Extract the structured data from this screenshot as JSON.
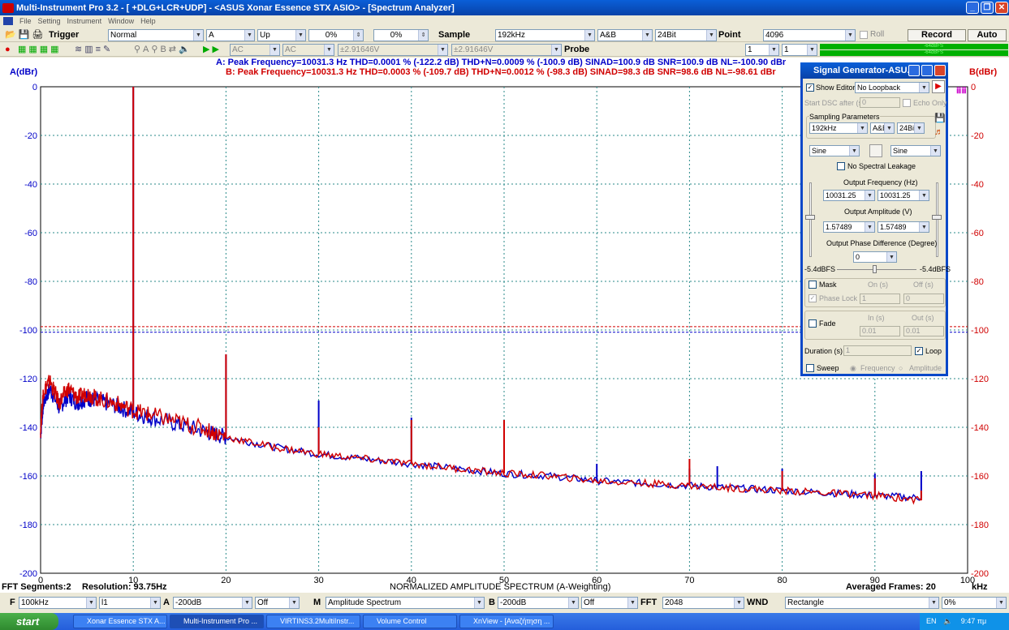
{
  "app": {
    "title": "Multi-Instrument Pro 3.2   - [ +DLG+LCR+UDP]   - <ASUS Xonar Essence STX ASIO> - [Spectrum Analyzer]"
  },
  "menu": [
    "File",
    "Setting",
    "Instrument",
    "Window",
    "Help"
  ],
  "toolbar1": {
    "trigger_label": "Trigger",
    "trigger_mode": "Normal",
    "channel": "A",
    "edge": "Up",
    "level1": "0%",
    "level2": "0%",
    "sample_label": "Sample",
    "sample_rate": "192kHz",
    "channels": "A&B",
    "bits": "24Bit",
    "point_label": "Point",
    "points": "4096",
    "roll_label": "Roll",
    "record_label": "Record",
    "auto_label": "Auto"
  },
  "toolbar2": {
    "coupling_a": "AC",
    "coupling_b": "AC",
    "range_a": "±2.91646V",
    "range_b": "±2.91646V",
    "probe_label": "Probe",
    "probe_a": "1",
    "probe_b": "1",
    "level_a": "-64dBFS",
    "level_b": "-64dBFS"
  },
  "info": {
    "a": "A: Peak Frequency=10031.3 Hz  THD=0.0001 % (-122.2 dB)  THD+N=0.0009 % (-100.9 dB)  SINAD=100.9 dB  SNR=100.9 dB  NL=-100.90 dBr",
    "b": "B: Peak Frequency=10031.3 Hz  THD=0.0003 % (-109.7 dB)  THD+N=0.0012 % (-98.3 dB)  SINAD=98.3 dB  SNR=98.6 dB  NL=-98.61 dBr"
  },
  "chart_data": {
    "type": "line",
    "title": "NORMALIZED AMPLITUDE SPECTRUM (A-Weighting)",
    "xlabel": "kHz",
    "ylabel_left": "A(dBr)",
    "ylabel_right": "B(dBr)",
    "xlim": [
      0,
      100
    ],
    "ylim": [
      -200,
      0
    ],
    "x_ticks": [
      0,
      10,
      20,
      30,
      40,
      50,
      60,
      70,
      80,
      90,
      100
    ],
    "y_ticks": [
      0,
      -20,
      -40,
      -60,
      -80,
      -100,
      -120,
      -140,
      -160,
      -180,
      -200
    ],
    "grid": true,
    "noise_level": {
      "a": -100.9,
      "b": -98.61
    },
    "series": [
      {
        "color": "#0000c8",
        "x": [
          0,
          0.3,
          1,
          2,
          3,
          4,
          5,
          6,
          8,
          10,
          12,
          15,
          18,
          20,
          25,
          30,
          35,
          40,
          45,
          50,
          55,
          60,
          65,
          70,
          75,
          80,
          85,
          90,
          95
        ],
        "y": [
          -143,
          -130,
          -124,
          -132,
          -127,
          -130,
          -128,
          -129,
          -131,
          -134,
          -136,
          -139,
          -142,
          -144,
          -148,
          -151,
          -153,
          -155,
          -157,
          -159,
          -160,
          -162,
          -163,
          -164,
          -165,
          -166,
          -167,
          -168,
          -169
        ],
        "spikes": [
          [
            10,
            0
          ],
          [
            20,
            -110
          ],
          [
            30,
            -129
          ],
          [
            40,
            -136
          ],
          [
            50,
            -137
          ],
          [
            60,
            -155
          ],
          [
            70,
            -157
          ],
          [
            73,
            -156
          ],
          [
            80,
            -157
          ],
          [
            90,
            -159
          ],
          [
            95,
            -158
          ]
        ]
      },
      {
        "color": "#d00000",
        "x": [
          0,
          0.3,
          1,
          2,
          3,
          4,
          5,
          6,
          8,
          10,
          12,
          15,
          18,
          20,
          25,
          30,
          35,
          40,
          45,
          50,
          55,
          60,
          65,
          70,
          75,
          80,
          85,
          90,
          95
        ],
        "y": [
          -141,
          -125,
          -121,
          -130,
          -124,
          -128,
          -126,
          -128,
          -130,
          -133,
          -135,
          -138,
          -141,
          -144,
          -148,
          -151,
          -153,
          -155,
          -157,
          -159,
          -160,
          -162,
          -163,
          -164,
          -165,
          -166,
          -167,
          -168,
          -170
        ],
        "spikes": [
          [
            10,
            0
          ],
          [
            20,
            -110
          ],
          [
            30,
            -140
          ],
          [
            40,
            -137
          ],
          [
            50,
            -137
          ],
          [
            70,
            -153
          ],
          [
            80,
            -158
          ],
          [
            90,
            -161
          ],
          [
            95,
            -166
          ]
        ]
      }
    ]
  },
  "status": {
    "segments": "FFT Segments:2",
    "resolution": "Resolution: 93.75Hz",
    "averaged": "Averaged Frames: 20"
  },
  "bottombar": {
    "f_label": "F",
    "freq": "100kHz",
    "scale": "l1",
    "a_label": "A",
    "a_min": "-200dB",
    "a_mode": "Off",
    "m_label": "M",
    "mode": "Amplitude Spectrum",
    "b_label": "B",
    "b_min": "-200dB",
    "b_mode": "Off",
    "fft_label": "FFT",
    "fft": "2048",
    "wnd_label": "WND",
    "window": "Rectangle",
    "overlap": "0%"
  },
  "siggen": {
    "title": "Signal Generator-ASU...",
    "show_editor": "Show Editor",
    "loopback": "No Loopback",
    "start_dsc": "Start DSC after (s)",
    "start_val": "0",
    "echo": "Echo Only",
    "sampling": "Sampling Parameters",
    "rate": "192kHz",
    "ch": "A&B",
    "bits": "24Bit",
    "wave_a": "Sine",
    "wave_b": "Sine",
    "no_leak": "No Spectral Leakage",
    "freq_label": "Output Frequency (Hz)",
    "freq_a": "10031.25",
    "freq_b": "10031.25",
    "amp_label": "Output Amplitude (V)",
    "amp_a": "1.57489",
    "amp_b": "1.57489",
    "phase_label": "Output Phase Difference (Degree)",
    "phase": "0",
    "lvl_a": "-5.4dBFS",
    "lvl_b": "-5.4dBFS",
    "mask": "Mask",
    "on": "On (s)",
    "off": "Off (s)",
    "phase_lock": "Phase Lock",
    "pl_on": "1",
    "pl_off": "0",
    "fade": "Fade",
    "in": "In (s)",
    "out": "Out (s)",
    "fade_in": "0.01",
    "fade_out": "0.01",
    "duration": "Duration (s)",
    "dur_val": "1",
    "loop": "Loop",
    "sweep": "Sweep",
    "sw_freq": "Frequency",
    "sw_amp": "Amplitude"
  },
  "taskbar": {
    "start": "start",
    "tasks": [
      "Xonar Essence STX A...",
      "Multi-Instrument Pro ...",
      "VIRTINS3.2MultiInstr...",
      "Volume Control",
      "XnView - [Αναζήτηση ..."
    ],
    "lang": "EN",
    "time": "9:47 πμ"
  }
}
